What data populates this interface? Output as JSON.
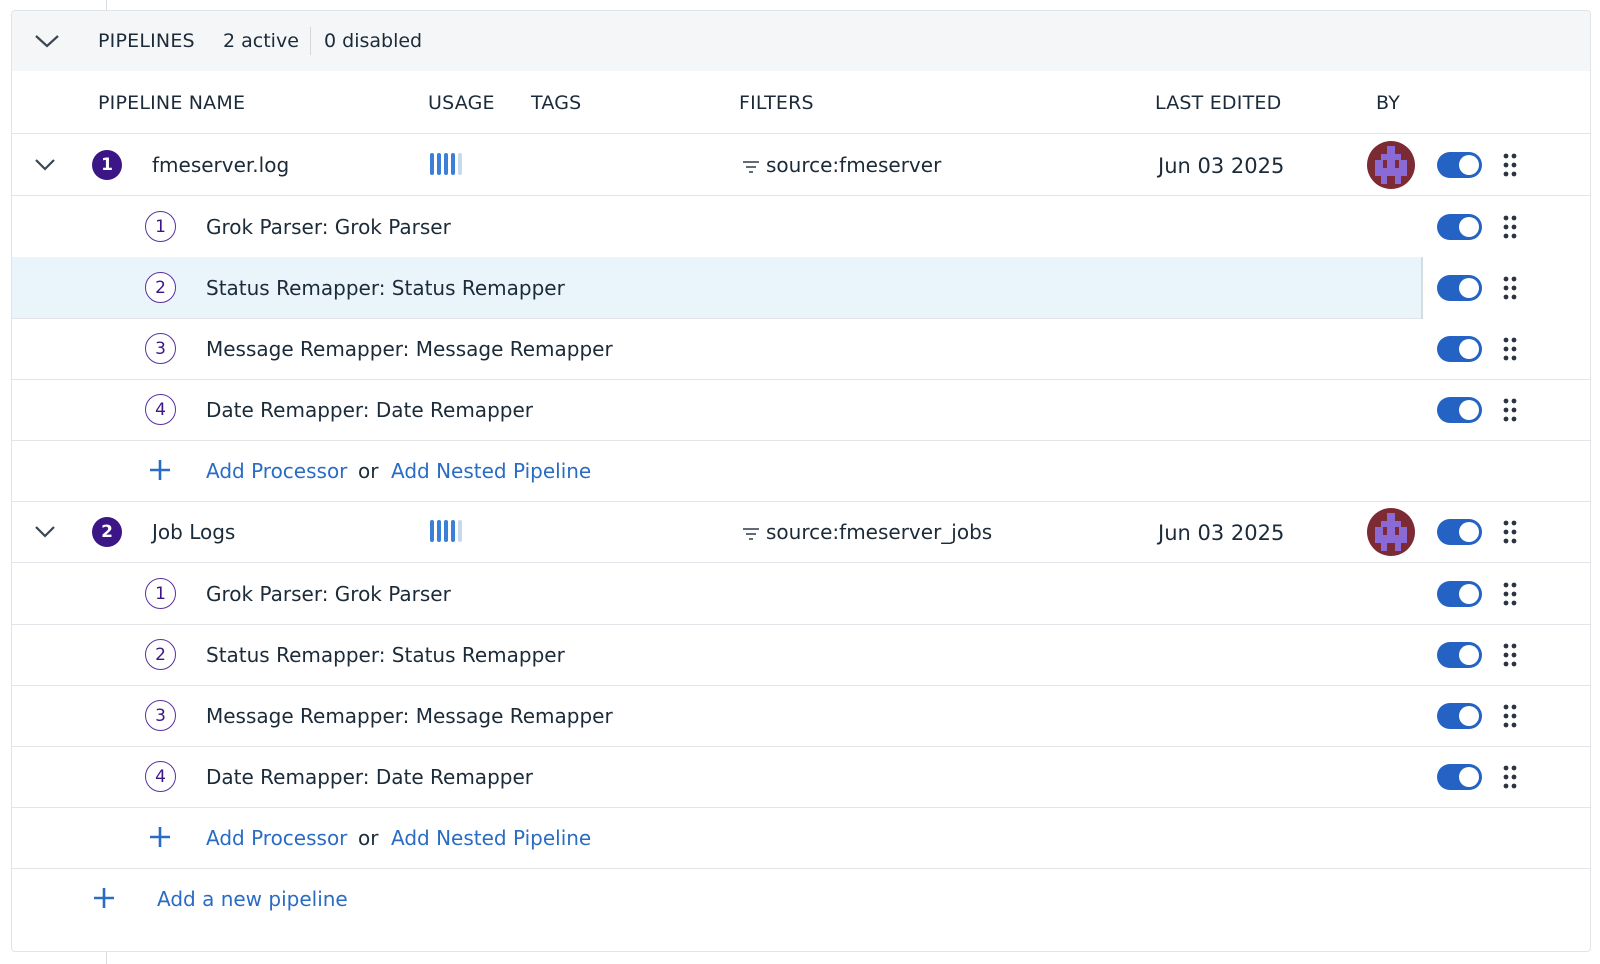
{
  "summary": {
    "title": "PIPELINES",
    "active": "2 active",
    "disabled": "0 disabled"
  },
  "columns": {
    "name": "PIPELINE NAME",
    "usage": "USAGE",
    "tags": "TAGS",
    "filters": "FILTERS",
    "last_edited": "LAST EDITED",
    "by": "BY"
  },
  "pipelines": [
    {
      "number": "1",
      "name": "fmeserver.log",
      "usage_level": 0.8,
      "filter": "source:fmeserver",
      "last_edited": "Jun 03 2025",
      "enabled": true,
      "processors": [
        {
          "number": "1",
          "label": "Grok Parser: Grok Parser",
          "enabled": true
        },
        {
          "number": "2",
          "label": "Status Remapper: Status Remapper",
          "enabled": true
        },
        {
          "number": "3",
          "label": "Message Remapper: Message Remapper",
          "enabled": true
        },
        {
          "number": "4",
          "label": "Date Remapper: Date Remapper",
          "enabled": true
        }
      ],
      "add_processor": "Add Processor",
      "or": "or",
      "add_nested": "Add Nested Pipeline"
    },
    {
      "number": "2",
      "name": "Job Logs",
      "usage_level": 0.8,
      "filter": "source:fmeserver_jobs",
      "last_edited": "Jun 03 2025",
      "enabled": true,
      "processors": [
        {
          "number": "1",
          "label": "Grok Parser: Grok Parser",
          "enabled": true
        },
        {
          "number": "2",
          "label": "Status Remapper: Status Remapper",
          "enabled": true
        },
        {
          "number": "3",
          "label": "Message Remapper: Message Remapper",
          "enabled": true
        },
        {
          "number": "4",
          "label": "Date Remapper: Date Remapper",
          "enabled": true
        }
      ],
      "add_processor": "Add Processor",
      "or": "or",
      "add_nested": "Add Nested Pipeline"
    }
  ],
  "add_pipeline": "Add a new pipeline",
  "colors": {
    "accent": "#2463c4",
    "link": "#2a6cc4",
    "badge": "#3c1586",
    "highlight_row": "#e9f4fb",
    "avatar_bg": "#7c2a34",
    "avatar_fg": "#8a6bd6"
  },
  "icons": {
    "collapse": "chevron-down-icon",
    "filter": "filter-icon",
    "add": "plus-icon",
    "drag": "drag-handle-icon",
    "toggle": "toggle-switch"
  }
}
